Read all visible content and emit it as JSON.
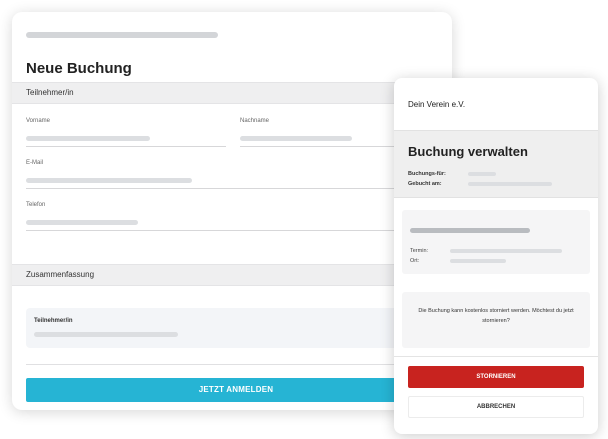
{
  "booking_form": {
    "title": "Neue Buchung",
    "participant_section": "Teilnehmer/in",
    "first_name_label": "Vorname",
    "last_name_label": "Nachname",
    "email_label": "E-Mail",
    "phone_label": "Telefon",
    "summary_section": "Zusammenfassung",
    "summary_participant_label": "Teilnehmer/in",
    "submit_label": "JETZT ANMELDEN"
  },
  "manage_booking": {
    "org_name": "Dein Verein e.V.",
    "title": "Buchung verwalten",
    "booked_for_label": "Buchungs-für:",
    "booked_at_label": "Gebucht am:",
    "date_label": "Termin:",
    "location_label": "Ort:",
    "info_text": "Die Buchung kann kostenlos storniert werden. Möchtest du jetzt stornieren?",
    "cancel_booking_label": "STORNIEREN",
    "abort_label": "ABBRECHEN"
  },
  "colors": {
    "primary_button": "#26b4d4",
    "danger_button": "#c8231f"
  }
}
